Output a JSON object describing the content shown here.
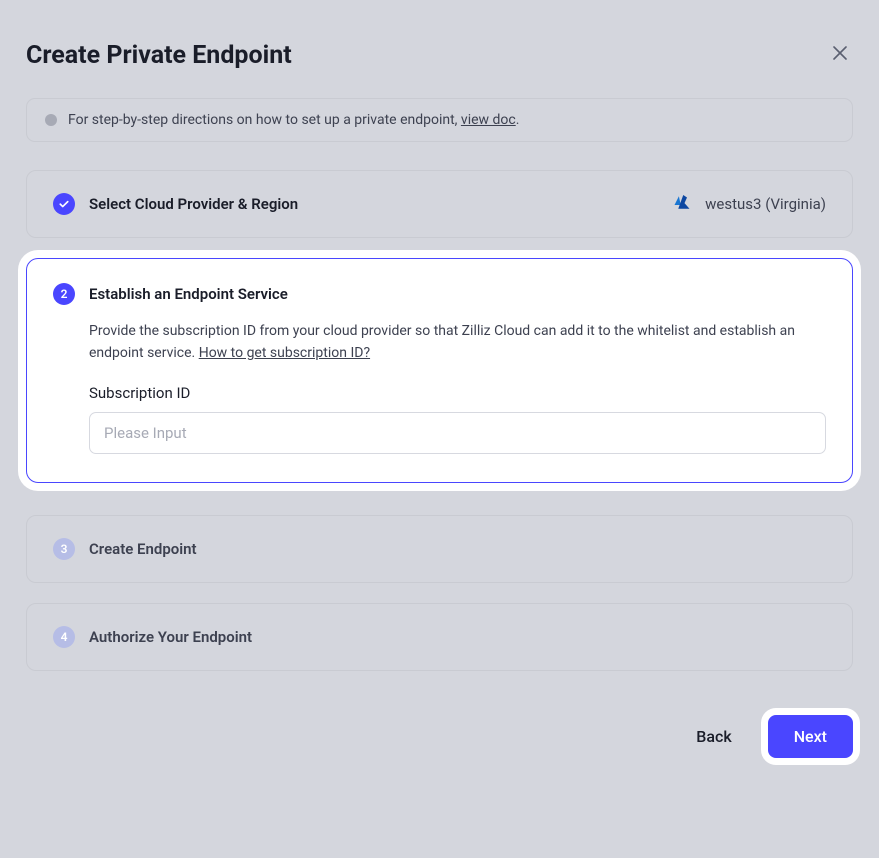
{
  "modal": {
    "title": "Create Private Endpoint"
  },
  "info": {
    "text_before": "For step-by-step directions on how to set up a private endpoint, ",
    "link_text": "view doc",
    "text_after": "."
  },
  "step1": {
    "title": "Select Cloud Provider & Region",
    "region": "westus3 (Virginia)"
  },
  "step2": {
    "number": "2",
    "title": "Establish an Endpoint Service",
    "desc_before": "Provide the subscription ID from your cloud provider so that Zilliz Cloud can add it to the whitelist and establish an endpoint service. ",
    "desc_link": "How to get subscription ID?",
    "field_label": "Subscription ID",
    "placeholder": "Please Input",
    "value": ""
  },
  "step3": {
    "number": "3",
    "title": "Create Endpoint"
  },
  "step4": {
    "number": "4",
    "title": "Authorize Your Endpoint"
  },
  "footer": {
    "back": "Back",
    "next": "Next"
  }
}
